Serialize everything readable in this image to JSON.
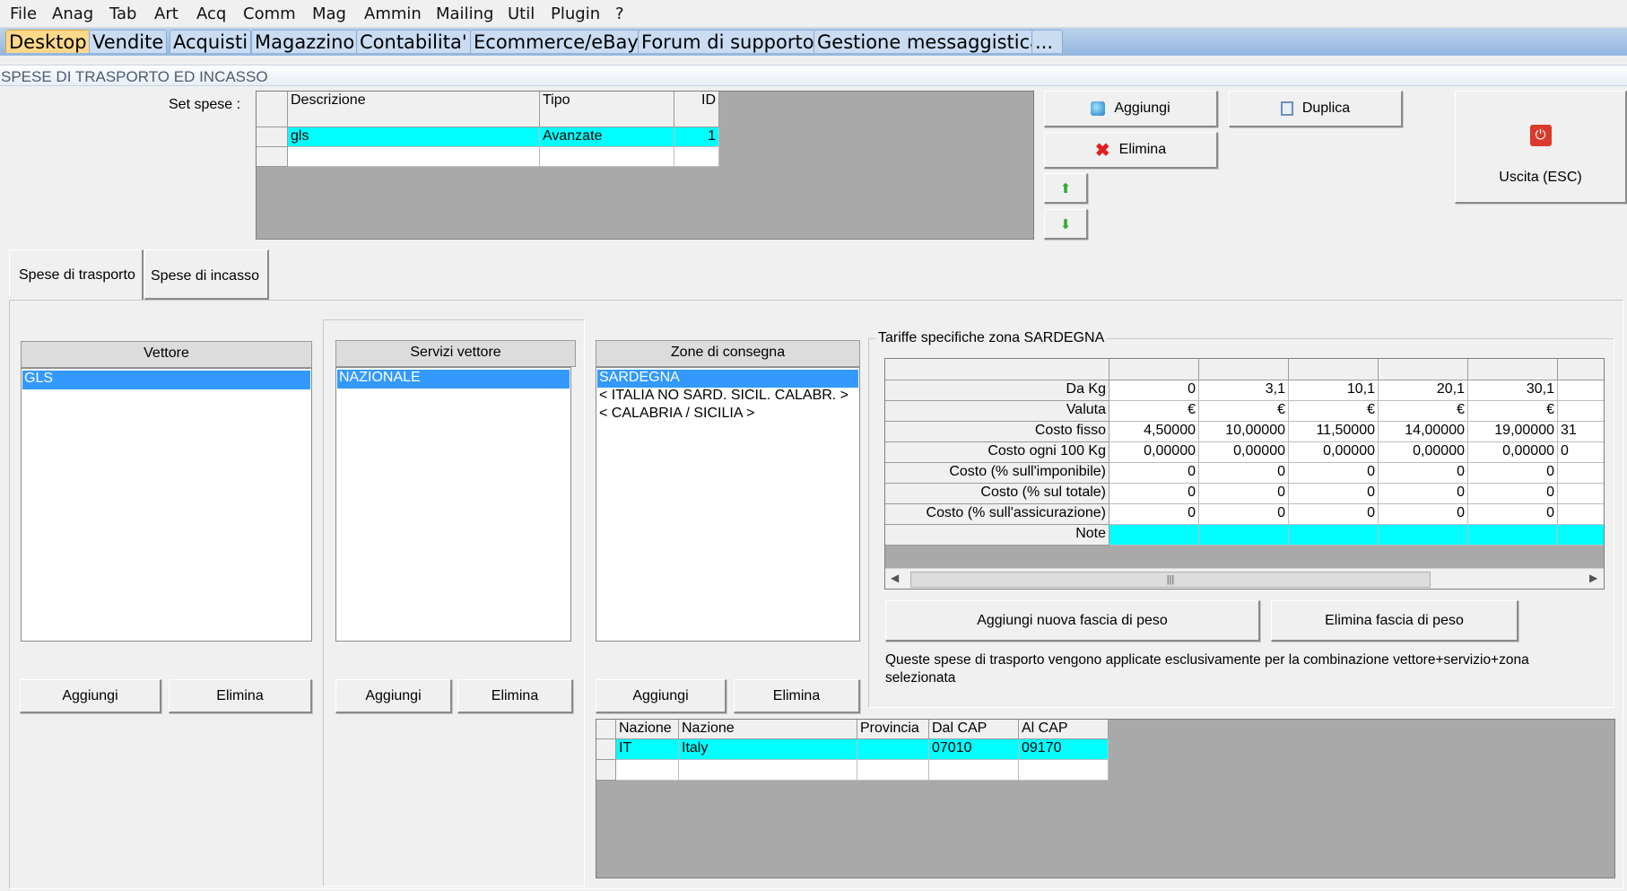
{
  "menu": [
    "File",
    "Anag",
    "Tab",
    "Art",
    "Acq",
    "Comm",
    "Mag",
    "Ammin",
    "Mailing",
    "Util",
    "Plugin",
    "?"
  ],
  "tabs": [
    "Desktop",
    "Vendite",
    "Acquisti",
    "Magazzino",
    "Contabilita'",
    "Ecommerce/eBay",
    "Forum di supporto",
    "Gestione messaggistica",
    "..."
  ],
  "window_title": "SPESE DI TRASPORTO ED INCASSO",
  "set_spese": {
    "label": "Set spese :",
    "columns": [
      "Descrizione",
      "Tipo",
      "ID"
    ],
    "rows": [
      {
        "descrizione": "gls",
        "tipo": "Avanzate",
        "id": "1"
      }
    ]
  },
  "buttons": {
    "aggiungi": "Aggiungi",
    "duplica": "Duplica",
    "elimina": "Elimina",
    "uscita": "Uscita (ESC)"
  },
  "subtabs": [
    "Spese di trasporto",
    "Spese di incasso"
  ],
  "vettore": {
    "header": "Vettore",
    "items": [
      "GLS"
    ],
    "add": "Aggiungi",
    "del": "Elimina"
  },
  "servizi": {
    "header": "Servizi vettore",
    "items": [
      "NAZIONALE"
    ],
    "add": "Aggiungi",
    "del": "Elimina"
  },
  "zone": {
    "header": "Zone di consegna",
    "items": [
      "SARDEGNA",
      "< ITALIA NO SARD. SICIL. CALABR. >",
      "< CALABRIA / SICILIA >"
    ],
    "add": "Aggiungi",
    "del": "Elimina"
  },
  "tariffe": {
    "title": "Tariffe specifiche zona SARDEGNA",
    "rows": [
      {
        "label": "Da Kg",
        "values": [
          "0",
          "3,1",
          "10,1",
          "20,1",
          "30,1",
          ""
        ]
      },
      {
        "label": "Valuta",
        "values": [
          "€",
          "€",
          "€",
          "€",
          "€",
          ""
        ]
      },
      {
        "label": "Costo fisso",
        "values": [
          "4,50000",
          "10,00000",
          "11,50000",
          "14,00000",
          "19,00000",
          "31"
        ]
      },
      {
        "label": "Costo ogni 100 Kg",
        "values": [
          "0,00000",
          "0,00000",
          "0,00000",
          "0,00000",
          "0,00000",
          "0"
        ]
      },
      {
        "label": "Costo (% sull'imponibile)",
        "values": [
          "0",
          "0",
          "0",
          "0",
          "0",
          ""
        ]
      },
      {
        "label": "Costo (% sul totale)",
        "values": [
          "0",
          "0",
          "0",
          "0",
          "0",
          ""
        ]
      },
      {
        "label": "Costo (% sull'assicurazione)",
        "values": [
          "0",
          "0",
          "0",
          "0",
          "0",
          ""
        ]
      },
      {
        "label": "Note",
        "values": [
          "",
          "",
          "",
          "",
          "",
          ""
        ]
      }
    ],
    "add_band": "Aggiungi nuova fascia di peso",
    "del_band": "Elimina fascia di peso",
    "note_text": "Queste spese di trasporto vengono applicate esclusivamente per la combinazione vettore+servizio+zona selezionata"
  },
  "nazioni": {
    "columns": [
      "Nazione",
      "Nazione",
      "Provincia",
      "Dal CAP",
      "Al CAP"
    ],
    "rows": [
      {
        "code": "IT",
        "name": "Italy",
        "provincia": "",
        "dal": "07010",
        "al": "09170"
      }
    ]
  }
}
